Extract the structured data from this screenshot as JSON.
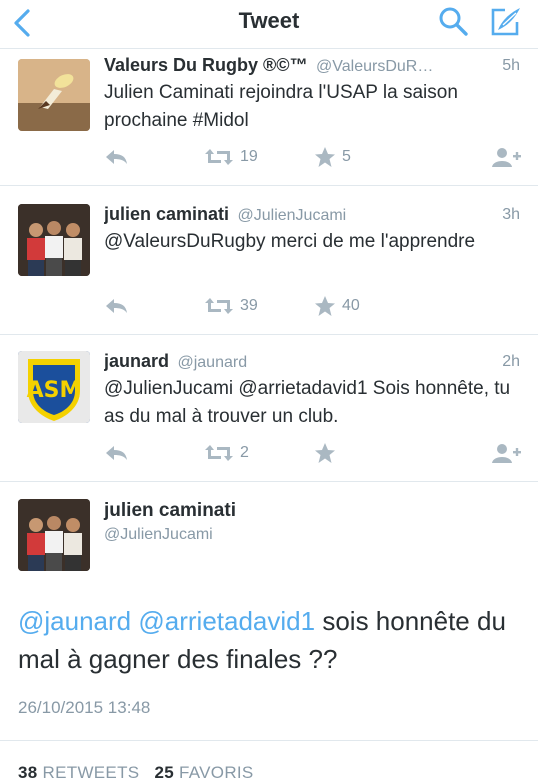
{
  "navbar": {
    "title": "Tweet"
  },
  "tweets": [
    {
      "name": "Valeurs Du Rugby ®©™",
      "handle": "@ValeursDuR…",
      "time": "5h",
      "text": "Julien Caminati rejoindra l'USAP la saison prochaine #Midol",
      "retweets": "19",
      "favorites": "5"
    },
    {
      "name": "julien caminati",
      "handle": "@JulienJucami",
      "time": "3h",
      "text": "@ValeursDuRugby merci de me l'apprendre",
      "retweets": "39",
      "favorites": "40"
    },
    {
      "name": "jaunard",
      "handle": "@jaunard",
      "time": "2h",
      "text": "@JulienJucami @arrietadavid1 Sois honnête, tu as du mal à trouver un club.",
      "retweets": "2",
      "favorites": ""
    }
  ],
  "detail": {
    "name": "julien caminati",
    "handle": "@JulienJucami",
    "mention1": "@jaunard",
    "mention2": "@arrietadavid1",
    "text": "sois honnête du mal à gagner des finales ??",
    "timestamp": "26/10/2015 13:48",
    "retweet_count": "38",
    "retweet_label": "RETWEETS",
    "favorite_count": "25",
    "favorite_label": "FAVORIS"
  },
  "icons": {
    "accent": "#55acee",
    "muted": "#aab8c2"
  }
}
